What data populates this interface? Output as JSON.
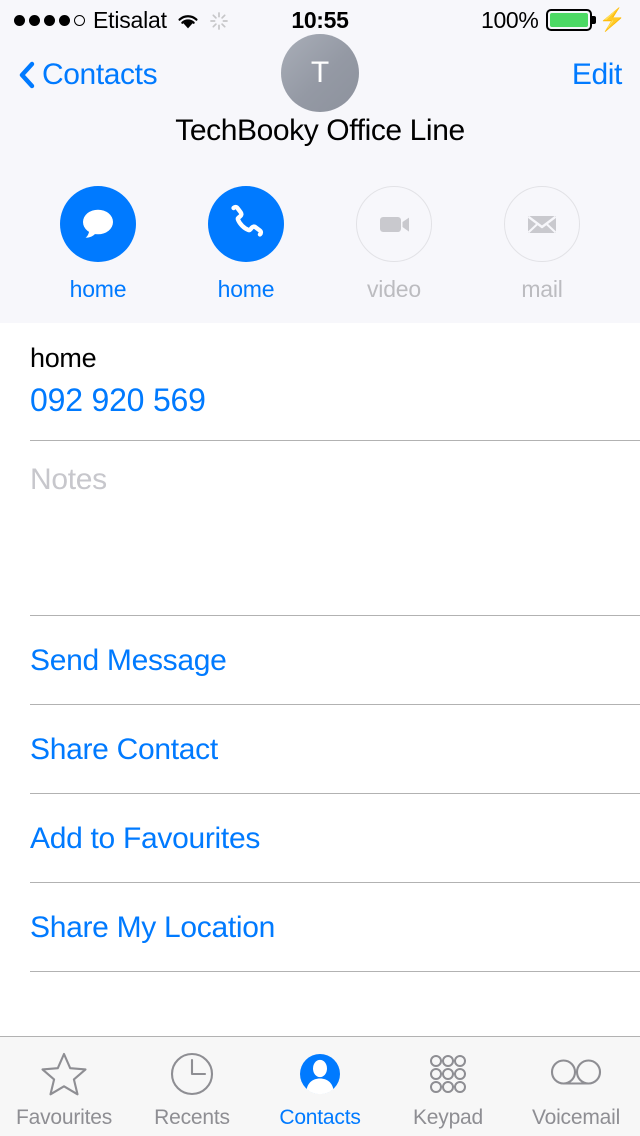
{
  "status_bar": {
    "signal_dots_filled": 4,
    "signal_dots_total": 5,
    "carrier": "Etisalat",
    "wifi_icon": "wifi-icon",
    "activity_icon": "activity-spinner-icon",
    "time": "10:55",
    "battery_percent": "100%",
    "battery_level": 100,
    "charging": true,
    "battery_color": "#4CD964"
  },
  "nav": {
    "back_label": "Contacts",
    "back_icon": "chevron-left-icon",
    "edit_label": "Edit"
  },
  "contact": {
    "avatar_initial": "T",
    "name": "TechBooky Office Line"
  },
  "actions": [
    {
      "label": "home",
      "icon": "message-icon",
      "enabled": true
    },
    {
      "label": "home",
      "icon": "phone-icon",
      "enabled": true
    },
    {
      "label": "video",
      "icon": "video-camera-icon",
      "enabled": false
    },
    {
      "label": "mail",
      "icon": "mail-envelope-icon",
      "enabled": false
    }
  ],
  "details": {
    "phone_label": "home",
    "phone_number": "092 920 569",
    "notes_placeholder": "Notes"
  },
  "links": [
    {
      "label": "Send Message"
    },
    {
      "label": "Share Contact"
    },
    {
      "label": "Add to Favourites"
    },
    {
      "label": "Share My Location"
    }
  ],
  "tabs": [
    {
      "label": "Favourites",
      "icon": "star-icon",
      "active": false
    },
    {
      "label": "Recents",
      "icon": "clock-icon",
      "active": false
    },
    {
      "label": "Contacts",
      "icon": "person-circle-icon",
      "active": true
    },
    {
      "label": "Keypad",
      "icon": "keypad-dots-icon",
      "active": false
    },
    {
      "label": "Voicemail",
      "icon": "voicemail-icon",
      "active": false
    }
  ],
  "colors": {
    "accent": "#007AFF",
    "disabled": "#BCBCC0",
    "header_bg": "#F7F7FB",
    "tabbar_bg": "#F7F7F7",
    "separator": "#B2B2B2"
  }
}
